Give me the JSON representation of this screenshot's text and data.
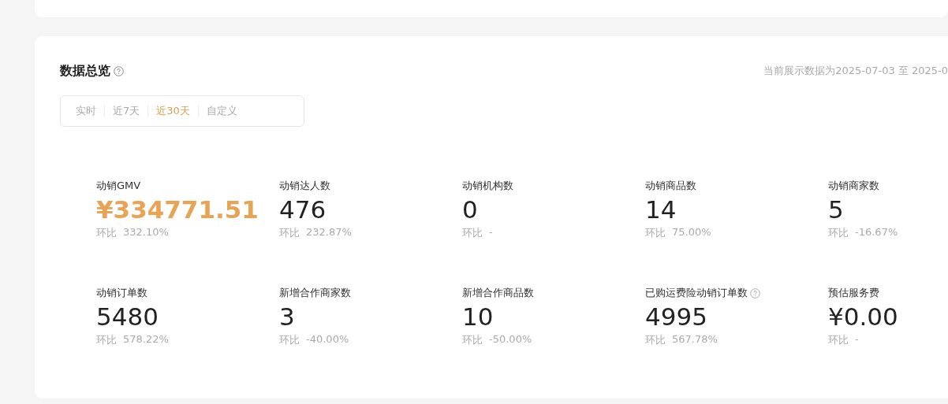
{
  "overview": {
    "title": "数据总览",
    "date_range": "当前展示数据为2025-07-03 至 2025-0",
    "tabs": [
      {
        "label": "实时",
        "selected": false
      },
      {
        "label": "近7天",
        "selected": false
      },
      {
        "label": "近30天",
        "selected": true
      },
      {
        "label": "自定义",
        "selected": false
      }
    ],
    "metrics": [
      {
        "label": "动销GMV",
        "value": "¥334771.51",
        "highlight": true,
        "help": false,
        "compare_label": "环比",
        "change": "332.10%"
      },
      {
        "label": "动销达人数",
        "value": "476",
        "highlight": false,
        "help": false,
        "compare_label": "环比",
        "change": "232.87%"
      },
      {
        "label": "动销机构数",
        "value": "0",
        "highlight": false,
        "help": false,
        "compare_label": "环比",
        "change": "-"
      },
      {
        "label": "动销商品数",
        "value": "14",
        "highlight": false,
        "help": false,
        "compare_label": "环比",
        "change": "75.00%"
      },
      {
        "label": "动销商家数",
        "value": "5",
        "highlight": false,
        "help": false,
        "compare_label": "环比",
        "change": "-16.67%"
      },
      {
        "label": "动销订单数",
        "value": "5480",
        "highlight": false,
        "help": false,
        "compare_label": "环比",
        "change": "578.22%"
      },
      {
        "label": "新增合作商家数",
        "value": "3",
        "highlight": false,
        "help": false,
        "compare_label": "环比",
        "change": "-40.00%"
      },
      {
        "label": "新增合作商品数",
        "value": "10",
        "highlight": false,
        "help": false,
        "compare_label": "环比",
        "change": "-50.00%"
      },
      {
        "label": "已购运费险动销订单数",
        "value": "4995",
        "highlight": false,
        "help": true,
        "compare_label": "环比",
        "change": "567.78%"
      },
      {
        "label": "预估服务费",
        "value": "¥0.00",
        "highlight": false,
        "help": false,
        "compare_label": "环比",
        "change": "-"
      }
    ]
  }
}
